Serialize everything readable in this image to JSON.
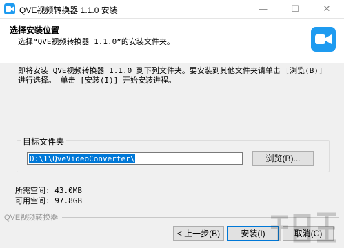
{
  "window": {
    "title": "QVE视频转换器 1.1.0 安装",
    "minimize": "—",
    "maximize": "☐",
    "close": "✕"
  },
  "header": {
    "title": "选择安装位置",
    "subtitle": "选择“QVE视频转换器 1.1.0”的安装文件夹。",
    "icon": "video-camera-icon"
  },
  "body": {
    "description": "即将安装 QVE视频转换器 1.1.0 到下列文件夹。要安装到其他文件夹请单击 [浏览(B)] 进行选择。 单击 [安装(I)] 开始安装进程。",
    "group_label": "目标文件夹",
    "path_value": "D:\\1\\QveVideoConverter\\",
    "browse_label": "浏览(B)...",
    "space_required": "所需空间: 43.0MB",
    "space_available": "可用空间: 97.8GB"
  },
  "footer": {
    "brand": "QVE视频转换器",
    "back_label": "< 上一步(B)",
    "install_label": "安装(I)",
    "cancel_label": "取消(C)"
  },
  "colors": {
    "accent": "#1e9bf0",
    "selection": "#0078d7"
  }
}
